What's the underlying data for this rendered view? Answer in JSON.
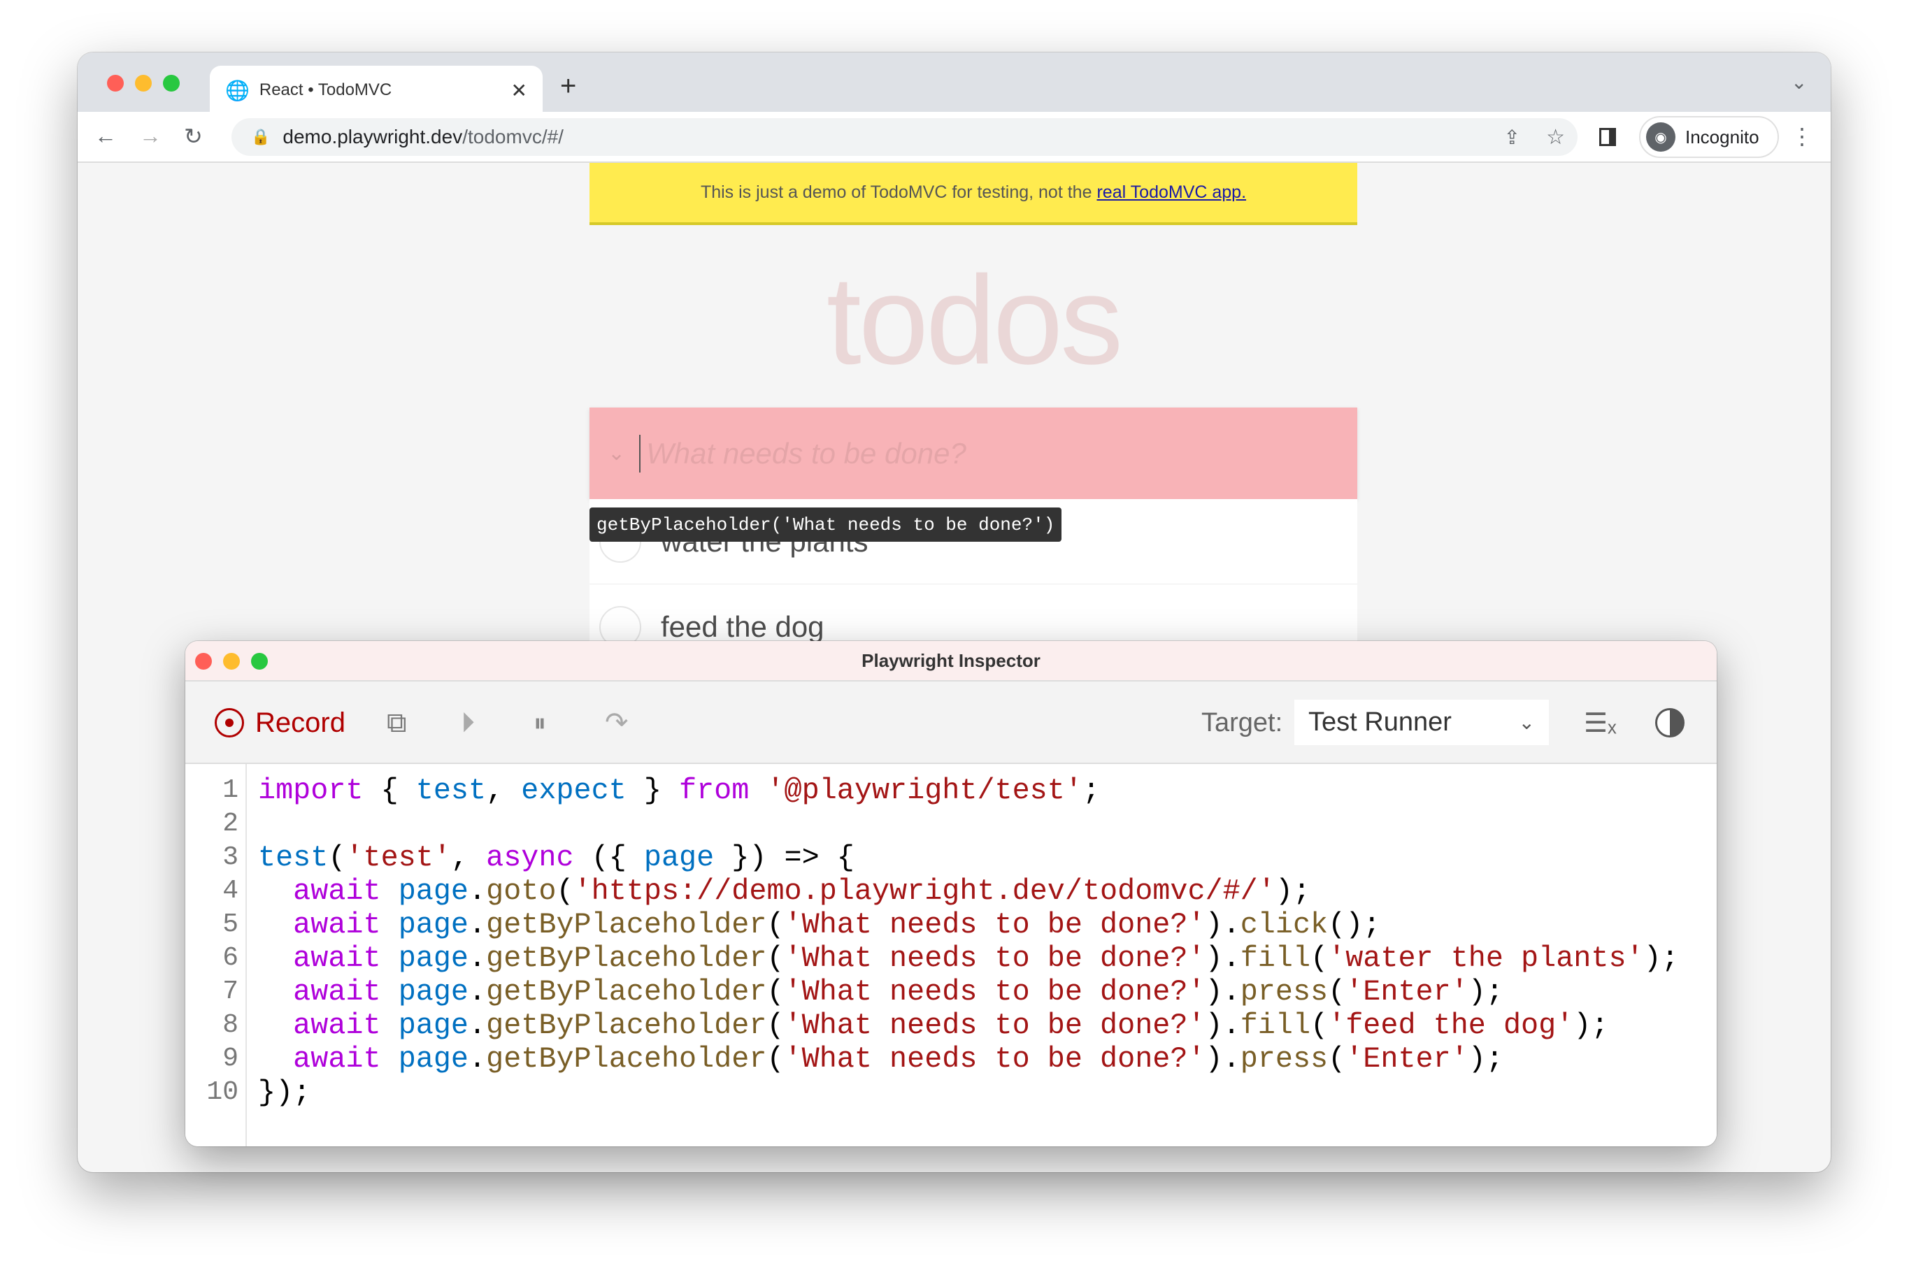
{
  "browser": {
    "tab_title": "React • TodoMVC",
    "url_host": "demo.playwright.dev",
    "url_path": "/todomvc/#/",
    "profile_label": "Incognito"
  },
  "page": {
    "banner_text": "This is just a demo of TodoMVC for testing, not the",
    "banner_link": "real TodoMVC app.",
    "heading": "todos",
    "new_todo_placeholder": "What needs to be done?",
    "items": [
      "water the plants",
      "feed the dog"
    ],
    "tooltip": "getByPlaceholder('What needs to be done?')",
    "highlight_color": "#f8b3b7"
  },
  "inspector": {
    "title": "Playwright Inspector",
    "record_label": "Record",
    "target_label": "Target:",
    "target_value": "Test Runner",
    "colors": {
      "keyword": "#af00db",
      "identifier": "#0070c1",
      "string": "#a31515",
      "method": "#795e26",
      "record": "#b00000"
    },
    "code": [
      [
        [
          "import",
          "k"
        ],
        [
          " { ",
          ""
        ],
        [
          "test",
          "v"
        ],
        [
          ", ",
          ""
        ],
        [
          "expect",
          "v"
        ],
        [
          " } ",
          ""
        ],
        [
          "from",
          "k"
        ],
        [
          " ",
          ""
        ],
        [
          "'@playwright/test'",
          "s"
        ],
        [
          ";",
          ""
        ]
      ],
      [],
      [
        [
          "test",
          "v"
        ],
        [
          "(",
          ""
        ],
        [
          "'test'",
          "s"
        ],
        [
          ", ",
          ""
        ],
        [
          "async",
          "k"
        ],
        [
          " ({ ",
          ""
        ],
        [
          "page",
          "v"
        ],
        [
          " }) => {",
          ""
        ]
      ],
      [
        [
          "  ",
          ""
        ],
        [
          "await",
          "k"
        ],
        [
          " ",
          ""
        ],
        [
          "page",
          "v"
        ],
        [
          ".",
          ""
        ],
        [
          "goto",
          "m"
        ],
        [
          "(",
          ""
        ],
        [
          "'https://demo.playwright.dev/todomvc/#/'",
          "s"
        ],
        [
          ");",
          ""
        ]
      ],
      [
        [
          "  ",
          ""
        ],
        [
          "await",
          "k"
        ],
        [
          " ",
          ""
        ],
        [
          "page",
          "v"
        ],
        [
          ".",
          ""
        ],
        [
          "getByPlaceholder",
          "m"
        ],
        [
          "(",
          ""
        ],
        [
          "'What needs to be done?'",
          "s"
        ],
        [
          ").",
          ""
        ],
        [
          "click",
          "m"
        ],
        [
          "();",
          ""
        ]
      ],
      [
        [
          "  ",
          ""
        ],
        [
          "await",
          "k"
        ],
        [
          " ",
          ""
        ],
        [
          "page",
          "v"
        ],
        [
          ".",
          ""
        ],
        [
          "getByPlaceholder",
          "m"
        ],
        [
          "(",
          ""
        ],
        [
          "'What needs to be done?'",
          "s"
        ],
        [
          ").",
          ""
        ],
        [
          "fill",
          "m"
        ],
        [
          "(",
          ""
        ],
        [
          "'water the plants'",
          "s"
        ],
        [
          ");",
          ""
        ]
      ],
      [
        [
          "  ",
          ""
        ],
        [
          "await",
          "k"
        ],
        [
          " ",
          ""
        ],
        [
          "page",
          "v"
        ],
        [
          ".",
          ""
        ],
        [
          "getByPlaceholder",
          "m"
        ],
        [
          "(",
          ""
        ],
        [
          "'What needs to be done?'",
          "s"
        ],
        [
          ").",
          ""
        ],
        [
          "press",
          "m"
        ],
        [
          "(",
          ""
        ],
        [
          "'Enter'",
          "s"
        ],
        [
          ");",
          ""
        ]
      ],
      [
        [
          "  ",
          ""
        ],
        [
          "await",
          "k"
        ],
        [
          " ",
          ""
        ],
        [
          "page",
          "v"
        ],
        [
          ".",
          ""
        ],
        [
          "getByPlaceholder",
          "m"
        ],
        [
          "(",
          ""
        ],
        [
          "'What needs to be done?'",
          "s"
        ],
        [
          ").",
          ""
        ],
        [
          "fill",
          "m"
        ],
        [
          "(",
          ""
        ],
        [
          "'feed the dog'",
          "s"
        ],
        [
          ");",
          ""
        ]
      ],
      [
        [
          "  ",
          ""
        ],
        [
          "await",
          "k"
        ],
        [
          " ",
          ""
        ],
        [
          "page",
          "v"
        ],
        [
          ".",
          ""
        ],
        [
          "getByPlaceholder",
          "m"
        ],
        [
          "(",
          ""
        ],
        [
          "'What needs to be done?'",
          "s"
        ],
        [
          ").",
          ""
        ],
        [
          "press",
          "m"
        ],
        [
          "(",
          ""
        ],
        [
          "'Enter'",
          "s"
        ],
        [
          ");",
          ""
        ]
      ],
      [
        [
          "});",
          ""
        ]
      ]
    ]
  }
}
